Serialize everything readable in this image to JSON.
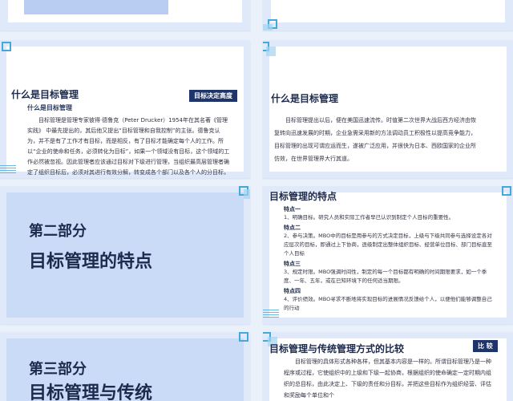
{
  "s1": {
    "title": "什么是目标管理",
    "tag": "目标决定高度",
    "subtitle": "什么是目标管理",
    "para": "目标管理是管理专家彼得·德鲁克（Peter Drucker）1954年在其名著《管理实践》 中最先提出的，其后他又提出“目标管理和自我控制”的主张。德鲁克认为，并不是有了工作才有目标，而是相反，有了目标才能确定每个人的工作。所以“企业的使命和任务，必须转化为目标”，如果一个领域没有目标，这个领域的工作必然被忽视。因此管理者应该通过目标对下级进行管理，当组织最高层管理者确定了组织目标后，必须对其进行有效分解，转变成各个部门以及各个人的分目标，管理者根据分目标的完成情况对下级进行考核、评价和奖惩。"
  },
  "s2": {
    "title": "什么是目标管理",
    "para": "目标管理提出以后，便在美国迅速流传。时值第二次世界大战后西方经济由恢复转向迅速发展的时期，企业急需采用新的方法调动员工积极性以提高竞争能力，目标管理的出现可谓应运而生，遂被广泛应用，并很快为日本、西欧国家的企业所仿效，在世界管理界大行其道。"
  },
  "s3": {
    "line1": "第二部分",
    "line2": "目标管理的特点"
  },
  "s4": {
    "title": "目标管理的特点",
    "items": [
      {
        "head": "特点一",
        "text": "1、明确目标。研究人员和实际工作者早已认识到制定个人目标的重要性。"
      },
      {
        "head": "特点二",
        "text": "2、参与决策。MBO中的目标是用参与的方式决定目标，上级与下级共同参与选择设定各对应层次的目标，即通过上下协商，逐级制定出整体组织目标、经营单位目标、部门目标直至个人目标"
      },
      {
        "head": "特点三",
        "text": "3、规定时限。MBO强调时间性，制定的每一个目标都有明确的时间期限要求，如一个季度、一年、五年，或在已知环境下的任何适当期限。"
      },
      {
        "head": "特点四",
        "text": "4、评价绩效。MBO寻求不断地将实现目标的进展情况反馈给个人，以便他们能够调整自己的行动"
      }
    ]
  },
  "s5": {
    "line1": "第三部分",
    "line2": "目标管理与传统"
  },
  "s6": {
    "title": "目标管理与传统管理方式的比较",
    "tag": "比 较",
    "para": "目标管理的具体形式各种各样，但其基本内容是一样的。所谓目标管理乃是一种程序或过程，它使组织中的上级和下级一起协商，根据组织的使命确定一定时期内组织的总目标，由此决定上、下级的责任和分目标，并把这些目标作为组织经营、评估和奖励每个单位和个"
  }
}
